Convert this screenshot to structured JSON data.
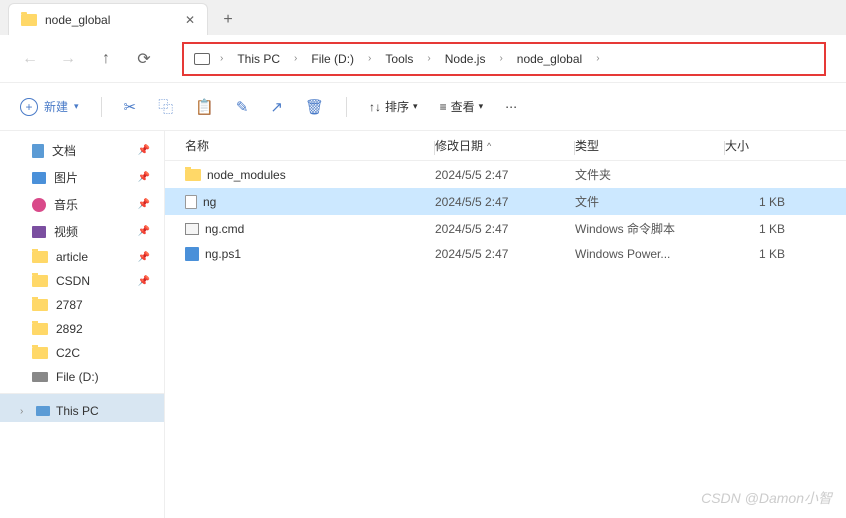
{
  "tab": {
    "title": "node_global"
  },
  "breadcrumb": [
    "This PC",
    "File (D:)",
    "Tools",
    "Node.js",
    "node_global"
  ],
  "toolbar": {
    "new": "新建",
    "sort": "排序",
    "view": "查看"
  },
  "headers": {
    "name": "名称",
    "date": "修改日期",
    "type": "类型",
    "size": "大小"
  },
  "sidebar": {
    "quick": [
      {
        "label": "文档",
        "icon": "doc",
        "pinned": true
      },
      {
        "label": "图片",
        "icon": "img",
        "pinned": true
      },
      {
        "label": "音乐",
        "icon": "music",
        "pinned": true
      },
      {
        "label": "视频",
        "icon": "vid",
        "pinned": true
      },
      {
        "label": "article",
        "icon": "folder",
        "pinned": true
      },
      {
        "label": "CSDN",
        "icon": "folder",
        "pinned": true
      },
      {
        "label": "2787",
        "icon": "folder",
        "pinned": false
      },
      {
        "label": "2892",
        "icon": "folder",
        "pinned": false
      },
      {
        "label": "C2C",
        "icon": "folder",
        "pinned": false
      },
      {
        "label": "File (D:)",
        "icon": "drive",
        "pinned": false
      }
    ],
    "thispc": "This PC"
  },
  "files": [
    {
      "name": "node_modules",
      "date": "2024/5/5 2:47",
      "type": "文件夹",
      "size": "",
      "icon": "folder",
      "selected": false
    },
    {
      "name": "ng",
      "date": "2024/5/5 2:47",
      "type": "文件",
      "size": "1 KB",
      "icon": "file",
      "selected": true
    },
    {
      "name": "ng.cmd",
      "date": "2024/5/5 2:47",
      "type": "Windows 命令脚本",
      "size": "1 KB",
      "icon": "cmd",
      "selected": false
    },
    {
      "name": "ng.ps1",
      "date": "2024/5/5 2:47",
      "type": "Windows Power...",
      "size": "1 KB",
      "icon": "ps1",
      "selected": false
    }
  ],
  "watermark": "CSDN @Damon小智"
}
